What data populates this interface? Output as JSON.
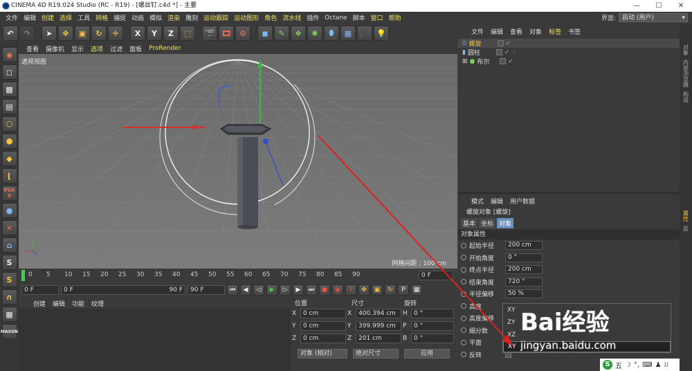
{
  "window": {
    "title": "CINEMA 4D R19.024 Studio (RC - R19) - [螺丝钉.c4d *] - 主要",
    "min": "—",
    "max": "☐",
    "close": "✕"
  },
  "menu": [
    "文件",
    "编辑",
    "创建",
    "选择",
    "工具",
    "网格",
    "捕捉",
    "动画",
    "模拟",
    "渲染",
    "雕刻",
    "运动跟踪",
    "运动图形",
    "角色",
    "流水线",
    "插件",
    "Octane",
    "脚本",
    "窗口",
    "帮助"
  ],
  "interface": {
    "label": "界面:",
    "value": "启动 (用户)"
  },
  "viewport": {
    "menu": [
      "查看",
      "摄像机",
      "显示",
      "选项",
      "过滤",
      "面板",
      "ProRender"
    ],
    "label": "透视视图",
    "grid_label": "网格间距 : 100 cm"
  },
  "timeline": {
    "ticks": [
      "0",
      "5",
      "10",
      "15",
      "20",
      "25",
      "30",
      "35",
      "40",
      "45",
      "50",
      "55",
      "60",
      "65",
      "70",
      "75",
      "80",
      "85",
      "90"
    ],
    "end_field": "0 F"
  },
  "transport": {
    "start": "0 F",
    "range_start": "0 F",
    "range_end": "90 F",
    "end": "90 F"
  },
  "material": {
    "menu": [
      "创建",
      "编辑",
      "功能",
      "纹理"
    ]
  },
  "coords": {
    "headers": [
      "位置",
      "尺寸",
      "旋转"
    ],
    "rows": [
      {
        "ax": "X",
        "pos": "0 cm",
        "sax": "X",
        "size": "400.394 cm",
        "rax": "H",
        "rot": "0 °"
      },
      {
        "ax": "Y",
        "pos": "0 cm",
        "sax": "Y",
        "size": "399.999 cm",
        "rax": "P",
        "rot": "0 °"
      },
      {
        "ax": "Z",
        "pos": "0 cm",
        "sax": "Z",
        "size": "201 cm",
        "rax": "B",
        "rot": "0 °"
      }
    ],
    "mode1": "对象 (相对)",
    "mode2": "绝对尺寸",
    "apply": "应用"
  },
  "objects": {
    "menu": [
      "文件",
      "编辑",
      "查看",
      "对象",
      "标签",
      "书签"
    ],
    "items": [
      "螺旋",
      "圆柱",
      "布尔"
    ]
  },
  "attributes": {
    "menu": [
      "模式",
      "编辑",
      "用户数据"
    ],
    "title": "螺旋对象 [螺旋]",
    "tabs": [
      "基本",
      "坐标",
      "对象"
    ],
    "section": "对象属性",
    "rows": [
      {
        "label": "起始半径",
        "value": "200 cm"
      },
      {
        "label": "开始角度",
        "value": "0 °"
      },
      {
        "label": "终点半径",
        "value": "200 cm"
      },
      {
        "label": "结束角度",
        "value": "720 °"
      },
      {
        "label": "半径偏移",
        "value": "50 %"
      },
      {
        "label": "高度",
        "value": ""
      },
      {
        "label": "高度偏移",
        "value": ""
      },
      {
        "label": "细分数",
        "value": ""
      },
      {
        "label": "平面",
        "value": ""
      },
      {
        "label": "反转",
        "value": ""
      }
    ],
    "plane_options": [
      "XY",
      "ZY",
      "XZ"
    ],
    "plane_current": "XY"
  },
  "sidetabs": [
    "对象",
    "内容浏览器",
    "构造",
    "属性",
    "层"
  ],
  "lefttool": {
    "psr": "PSR",
    "psr_val": "0"
  },
  "watermark": {
    "brand": "Bai经验",
    "url": "jingyan.baidu.com"
  },
  "ime": {
    "label": "五"
  }
}
